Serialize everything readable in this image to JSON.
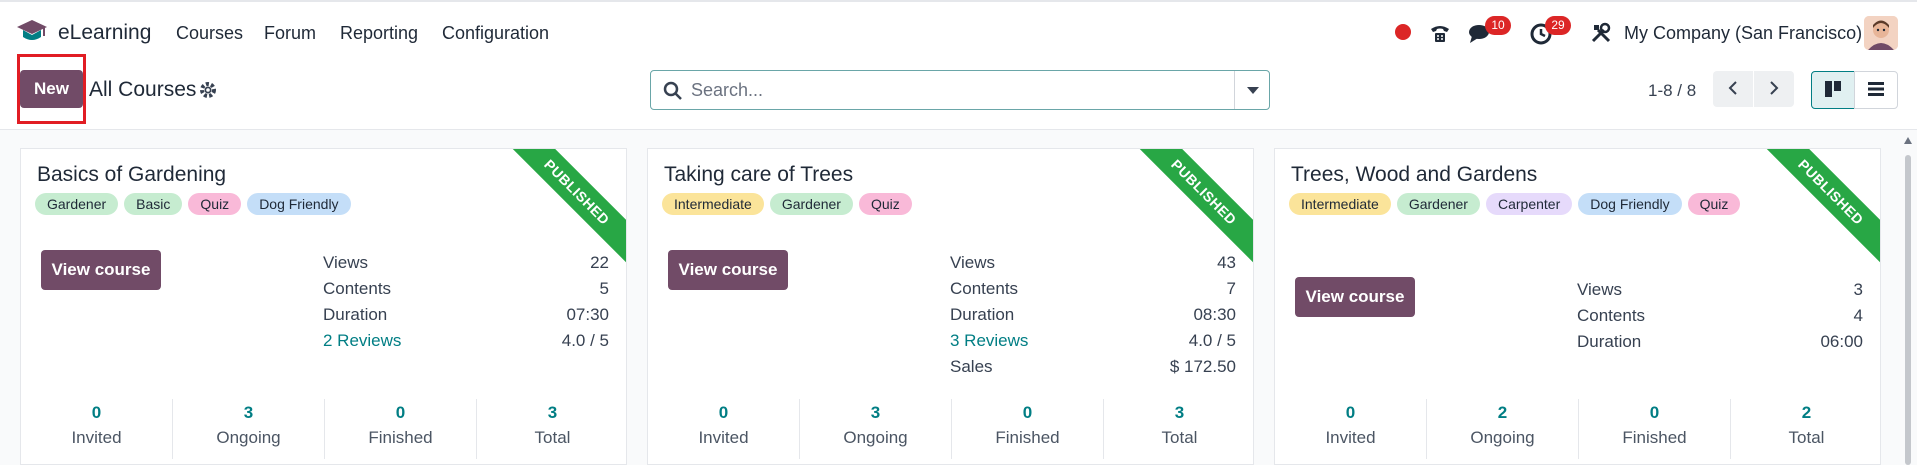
{
  "app": {
    "name": "eLearning",
    "menu": [
      "Courses",
      "Forum",
      "Reporting",
      "Configuration"
    ],
    "chat_badge": "10",
    "activity_badge": "29",
    "company": "My Company (San Francisco)"
  },
  "control": {
    "new_label": "New",
    "title": "All Courses",
    "search_placeholder": "Search...",
    "pager": "1-8 / 8"
  },
  "colors": {
    "primary": "#714b67",
    "accent": "#017e84",
    "ribbon": "#28a745",
    "tag_green": "#c6ecd0",
    "tag_pink": "#f9b9d8",
    "tag_blue": "#c4def8",
    "tag_yellow": "#fbe49a",
    "tag_purple": "#e6dafb"
  },
  "cards": [
    {
      "title": "Basics of Gardening",
      "ribbon": "PUBLISHED",
      "tags": [
        "Gardener",
        "Basic",
        "Quiz",
        "Dog Friendly"
      ],
      "button": "View course",
      "stats": [
        {
          "label": "Views",
          "value": "22"
        },
        {
          "label": "Contents",
          "value": "5"
        },
        {
          "label": "Duration",
          "value": "07:30"
        },
        {
          "label": "2 Reviews",
          "value": "4.0 / 5",
          "link": true
        }
      ],
      "counters": [
        {
          "num": "0",
          "label": "Invited"
        },
        {
          "num": "3",
          "label": "Ongoing"
        },
        {
          "num": "0",
          "label": "Finished"
        },
        {
          "num": "3",
          "label": "Total"
        }
      ]
    },
    {
      "title": "Taking care of Trees",
      "ribbon": "PUBLISHED",
      "tags": [
        "Intermediate",
        "Gardener",
        "Quiz"
      ],
      "button": "View course",
      "stats": [
        {
          "label": "Views",
          "value": "43"
        },
        {
          "label": "Contents",
          "value": "7"
        },
        {
          "label": "Duration",
          "value": "08:30"
        },
        {
          "label": "3 Reviews",
          "value": "4.0 / 5",
          "link": true
        },
        {
          "label": "Sales",
          "value": "$ 172.50"
        }
      ],
      "counters": [
        {
          "num": "0",
          "label": "Invited"
        },
        {
          "num": "3",
          "label": "Ongoing"
        },
        {
          "num": "0",
          "label": "Finished"
        },
        {
          "num": "3",
          "label": "Total"
        }
      ]
    },
    {
      "title": "Trees, Wood and Gardens",
      "ribbon": "PUBLISHED",
      "tags": [
        "Intermediate",
        "Gardener",
        "Carpenter",
        "Dog Friendly",
        "Quiz"
      ],
      "button": "View course",
      "stats": [
        {
          "label": "Views",
          "value": "3"
        },
        {
          "label": "Contents",
          "value": "4"
        },
        {
          "label": "Duration",
          "value": "06:00"
        }
      ],
      "counters": [
        {
          "num": "0",
          "label": "Invited"
        },
        {
          "num": "2",
          "label": "Ongoing"
        },
        {
          "num": "0",
          "label": "Finished"
        },
        {
          "num": "2",
          "label": "Total"
        }
      ]
    }
  ]
}
